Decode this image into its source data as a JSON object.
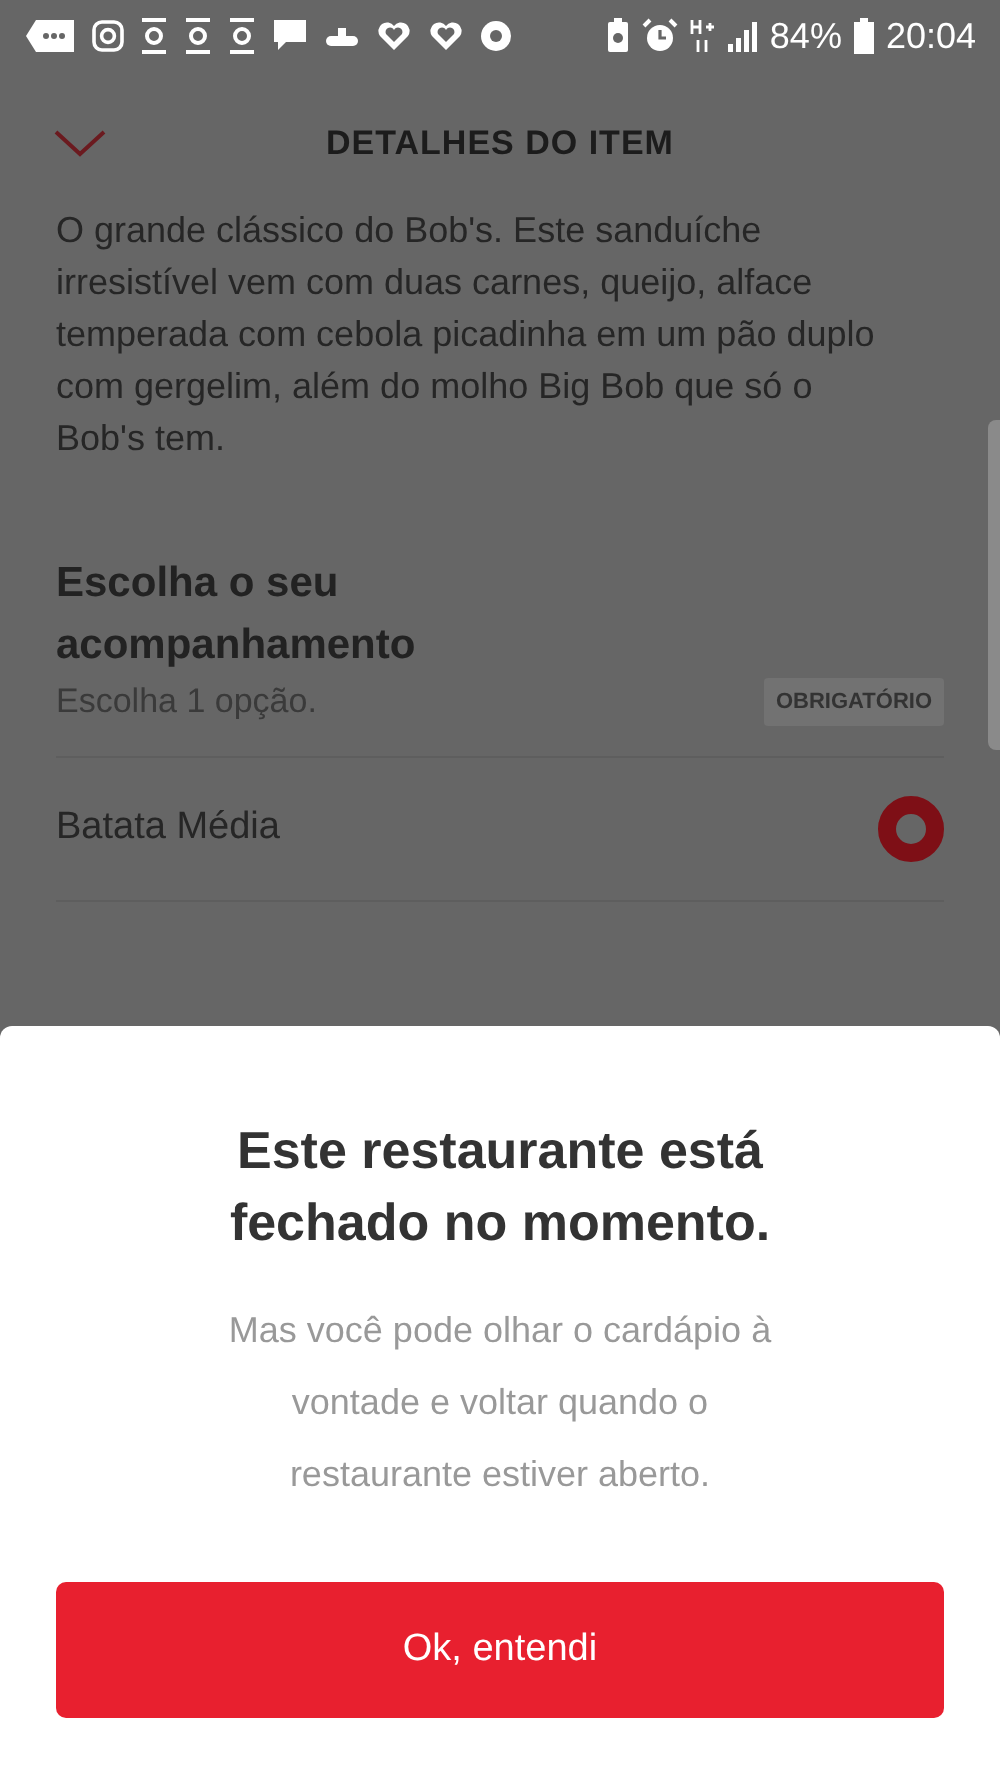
{
  "status_bar": {
    "battery": "84%",
    "time": "20:04"
  },
  "header": {
    "title": "DETALHES DO ITEM"
  },
  "description": "O grande clássico do Bob's. Este sanduíche irresistível vem com duas carnes, queijo, alface temperada com cebola picadinha em um pão duplo com gergelim, além do molho Big Bob que só o Bob's tem.",
  "section": {
    "title": "Escolha o seu acompanhamento",
    "subtitle": "Escolha 1 opção.",
    "badge": "OBRIGATÓRIO"
  },
  "options": [
    {
      "label": "Batata Média",
      "selected": true
    }
  ],
  "dialog": {
    "title": "Este restaurante está fechado no momento.",
    "message": "Mas você pode olhar o cardápio à vontade e voltar quando o restaurante estiver aberto.",
    "button": "Ok, entendi"
  }
}
